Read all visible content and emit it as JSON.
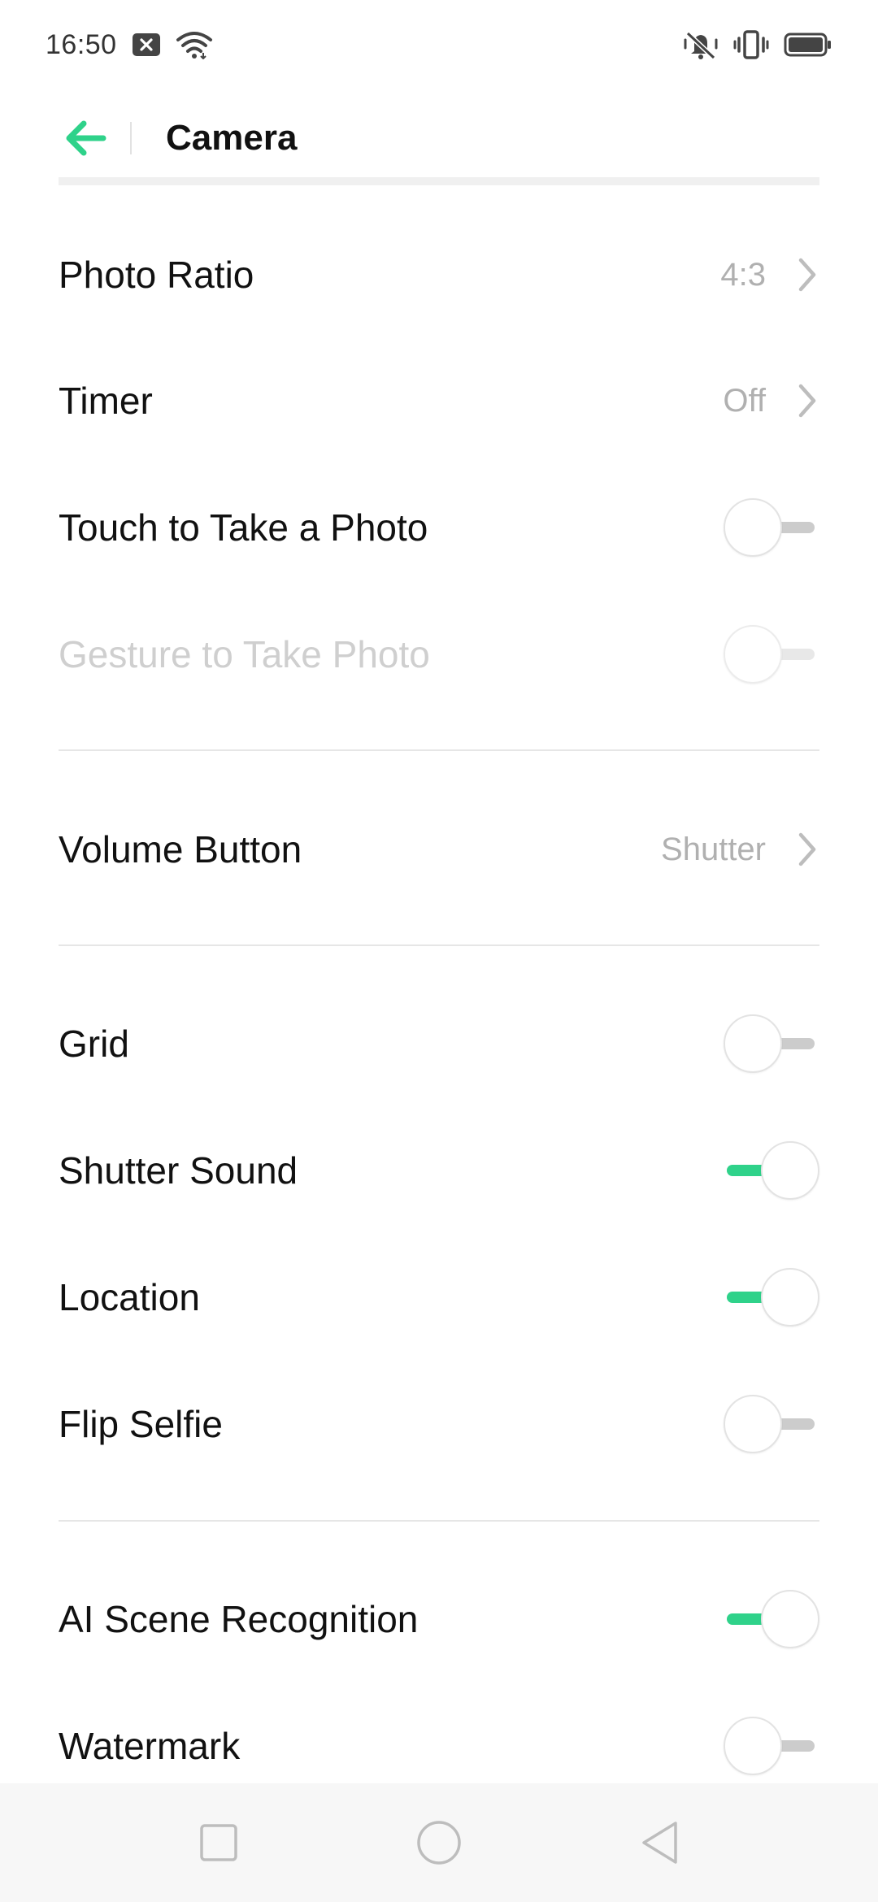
{
  "status_bar": {
    "time": "16:50"
  },
  "app_bar": {
    "title": "Camera"
  },
  "settings": {
    "photo_ratio": {
      "label": "Photo Ratio",
      "value": "4:3"
    },
    "timer": {
      "label": "Timer",
      "value": "Off"
    },
    "touch_to_take_photo": {
      "label": "Touch to Take a Photo",
      "enabled": false
    },
    "gesture_to_take_photo": {
      "label": "Gesture to Take Photo",
      "enabled": false,
      "disabled": true
    },
    "volume_button": {
      "label": "Volume Button",
      "value": "Shutter"
    },
    "grid": {
      "label": "Grid",
      "enabled": false
    },
    "shutter_sound": {
      "label": "Shutter Sound",
      "enabled": true
    },
    "location": {
      "label": "Location",
      "enabled": true
    },
    "flip_selfie": {
      "label": "Flip Selfie",
      "enabled": false
    },
    "ai_scene_recognition": {
      "label": "AI Scene Recognition",
      "enabled": true
    },
    "watermark": {
      "label": "Watermark",
      "enabled": false
    }
  },
  "colors": {
    "accent": "#2fd28a",
    "toggle_off": "#cccccc",
    "value_text": "#b0b0b0",
    "disabled_text": "#cfcfcf"
  },
  "icons": {
    "back": "arrow-left-icon",
    "chevron": "chevron-right-icon",
    "nav_recents": "square-icon",
    "nav_home": "circle-icon",
    "nav_back": "triangle-back-icon"
  }
}
